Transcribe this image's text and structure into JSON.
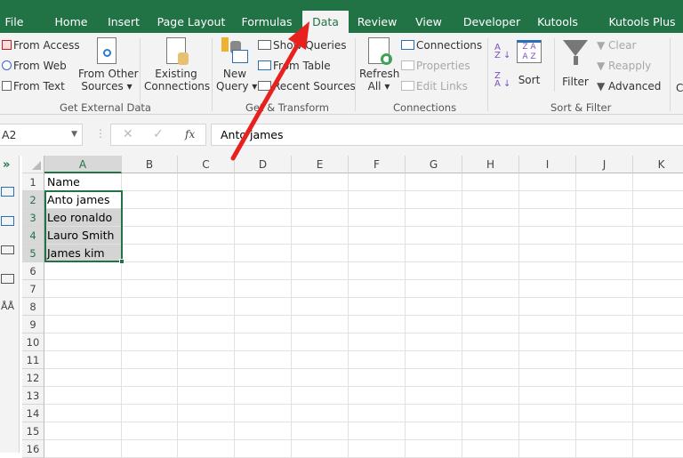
{
  "tabs": [
    "File",
    "Home",
    "Insert",
    "Page Layout",
    "Formulas",
    "Data",
    "Review",
    "View",
    "Developer",
    "Kutools ™",
    "Kutools Plus"
  ],
  "active_tab": "Data",
  "ribbon": {
    "get_external": {
      "from_access": "From Access",
      "from_web": "From Web",
      "from_text": "From Text",
      "from_other": "From Other",
      "sources": "Sources",
      "existing": "Existing",
      "connections": "Connections",
      "label": "Get External Data"
    },
    "get_transform": {
      "new": "New",
      "query": "Query",
      "show_queries": "Show Queries",
      "from_table": "From Table",
      "recent_sources": "Recent Sources",
      "label": "Get & Transform"
    },
    "connections": {
      "refresh": "Refresh",
      "all": "All",
      "connections": "Connections",
      "properties": "Properties",
      "edit_links": "Edit Links",
      "label": "Connections"
    },
    "sort_filter": {
      "sort": "Sort",
      "filter": "Filter",
      "clear": "Clear",
      "reapply": "Reapply",
      "advanced": "Advanced",
      "label": "Sort & Filter"
    }
  },
  "name_box": "A2",
  "formula": "Anto james",
  "fx": "fx",
  "columns": [
    "A",
    "B",
    "C",
    "D",
    "E",
    "F",
    "G",
    "H",
    "I",
    "J",
    "K"
  ],
  "rows": [
    "1",
    "2",
    "3",
    "4",
    "5",
    "6",
    "7",
    "8",
    "9",
    "10",
    "11",
    "12",
    "13",
    "14",
    "15",
    "16"
  ],
  "cells": [
    "Name",
    "Anto james",
    "Leo ronaldo",
    "Lauro Smith",
    "James kim"
  ],
  "colors": {
    "accent": "#217346",
    "arrow": "#e8201e"
  }
}
